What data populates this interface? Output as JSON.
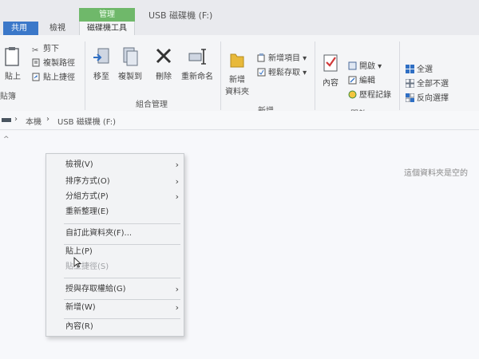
{
  "tabs": {
    "share": "共用",
    "view": "檢視",
    "manage": "管理",
    "drive_tools": "磁碟機工具"
  },
  "window_title": "USB 磁碟機 (F:)",
  "ribbon": {
    "clipboard": {
      "paste": "貼上",
      "cut": "剪下",
      "copy_path": "複製路徑",
      "paste_shortcut": "貼上捷徑",
      "label": "貼簿"
    },
    "organize": {
      "move_to": "移至",
      "copy_to": "複製到",
      "delete": "刪除",
      "rename": "重新命名",
      "label": "組合管理"
    },
    "new": {
      "new_folder_line1": "新增",
      "new_folder_line2": "資料夾",
      "new_item": "新增項目 ▾",
      "easy_access": "輕鬆存取 ▾",
      "label": "新增"
    },
    "open": {
      "properties": "內容",
      "open": "開啟 ▾",
      "edit": "編輯",
      "history": "歷程記錄",
      "label": "開啟"
    },
    "select": {
      "select_all": "全選",
      "select_none": "全部不選",
      "invert": "反向選擇",
      "label": "選取"
    }
  },
  "address": {
    "this_pc": "本機",
    "separator": "›",
    "drive": "USB 磁碟機 (F:)"
  },
  "content": {
    "empty_message": "這個資料夾是空的"
  },
  "context_menu": {
    "view": "檢視(V)",
    "sort_by": "排序方式(O)",
    "group_by": "分組方式(P)",
    "refresh": "重新整理(E)",
    "customize": "自訂此資料夾(F)...",
    "paste": "貼上(P)",
    "paste_shortcut": "貼上捷徑(S)",
    "give_access": "授與存取權給(G)",
    "new": "新增(W)",
    "properties": "內容(R)"
  },
  "colors": {
    "manage_tab": "#6fb86a",
    "share_tab": "#3b78c9",
    "accent_blue": "#2f6fc4"
  }
}
